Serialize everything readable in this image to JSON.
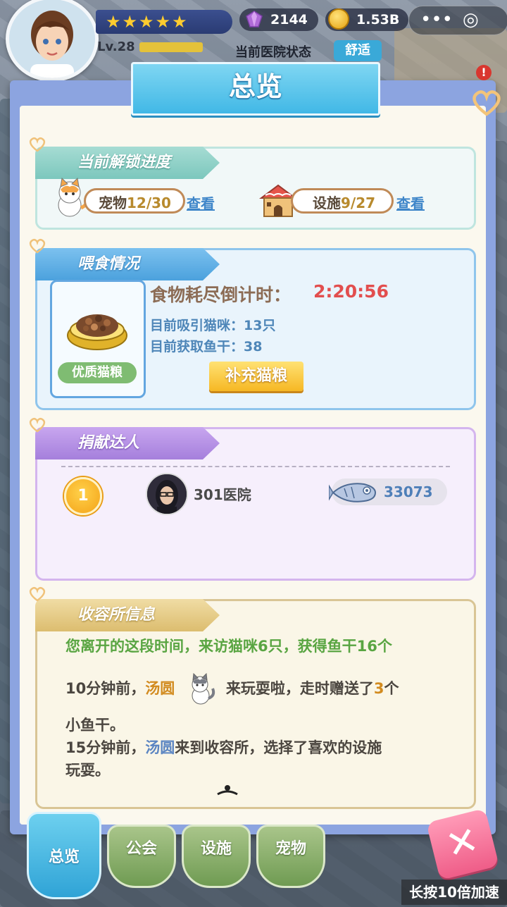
{
  "hud": {
    "stars": "★★★★★",
    "level": "Lv.28",
    "level_progress": 1.0,
    "gems": "2144",
    "coins": "1.53B",
    "more_menu": "•••",
    "target_button": "◎",
    "hospital_status_label": "当前医院状态",
    "hospital_status": "舒适"
  },
  "panel": {
    "title": "总览",
    "unlock": {
      "header": "当前解锁进度",
      "pets_label": "宠物",
      "pets_value": "12/30",
      "pets_link": "查看",
      "facilities_label": "设施",
      "facilities_value": "9/27",
      "facilities_link": "查看"
    },
    "feeding": {
      "header": "喂食情况",
      "food_name": "优质猫粮",
      "countdown_label": "食物耗尽倒计时：",
      "countdown": "2:20:56",
      "cats_line": "目前吸引猫咪：13只",
      "fish_line": "目前获取鱼干：38",
      "refill_button": "补充猫粮"
    },
    "donors": {
      "header": "捐献达人",
      "entries": [
        {
          "rank": "1",
          "name": "301医院",
          "fish": "33073"
        }
      ]
    },
    "shelter": {
      "header": "收容所信息",
      "line1": "您离开的这段时间，来访猫咪6只，获得鱼干16个",
      "line2_time": "10分钟前，",
      "line2_cat": "汤圆",
      "line2_rest": "来玩耍啦，走时赠送了",
      "line2_count": "3",
      "line2_unit": "个",
      "line3": "小鱼干。",
      "line4_time": "15分钟前，",
      "line4_cat": "汤圆",
      "line4_rest": "来到收容所，选择了喜欢的设施",
      "line5": "玩耍。"
    }
  },
  "tabs": [
    "总览",
    "公会",
    "设施",
    "宠物"
  ],
  "speed_hint": "长按10倍加速",
  "colors": {
    "accent_blue": "#41b8e6",
    "countdown_red": "#e24e4e",
    "panel_blue": "#8ca4e0"
  }
}
